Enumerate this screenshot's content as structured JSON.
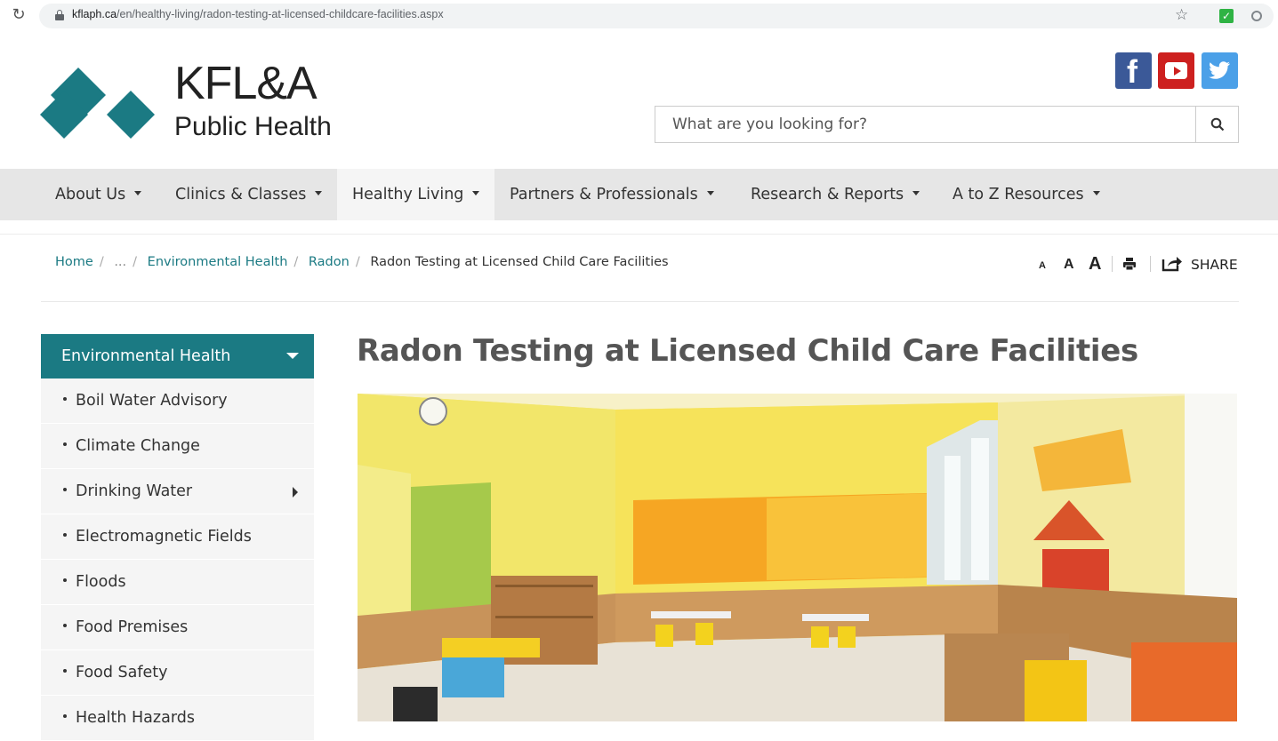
{
  "browser": {
    "url_host": "kflaph.ca",
    "url_path": "/en/healthy-living/radon-testing-at-licensed-childcare-facilities.aspx"
  },
  "header": {
    "logo_title": "KFL&A",
    "logo_subtitle": "Public Health",
    "search_placeholder": "What are you looking for?",
    "social": [
      "facebook-icon",
      "youtube-icon",
      "twitter-icon"
    ],
    "brand_color": "#1b7a83"
  },
  "nav": {
    "items": [
      {
        "label": "About Us"
      },
      {
        "label": "Clinics & Classes"
      },
      {
        "label": "Healthy Living",
        "active": true
      },
      {
        "label": "Partners & Professionals"
      },
      {
        "label": "Research & Reports"
      },
      {
        "label": "A to Z Resources"
      }
    ]
  },
  "breadcrumb": {
    "items": [
      "Home",
      "...",
      "Environmental Health",
      "Radon"
    ],
    "current": "Radon Testing at Licensed Child Care Facilities"
  },
  "tools": {
    "font_small": "A",
    "font_medium": "A",
    "font_large": "A",
    "share_label": "SHARE"
  },
  "sidebar": {
    "heading": "Environmental Health",
    "items": [
      {
        "label": "Boil Water Advisory"
      },
      {
        "label": "Climate Change"
      },
      {
        "label": "Drinking Water",
        "has_submenu": true
      },
      {
        "label": "Electromagnetic Fields"
      },
      {
        "label": "Floods"
      },
      {
        "label": "Food Premises"
      },
      {
        "label": "Food Safety"
      },
      {
        "label": "Health Hazards"
      }
    ]
  },
  "main": {
    "title": "Radon Testing at Licensed Child Care Facilities",
    "hero_image": "classroom-photo"
  }
}
